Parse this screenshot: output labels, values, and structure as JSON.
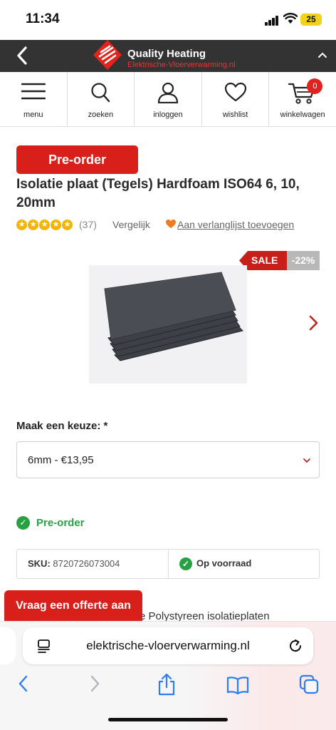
{
  "status_bar": {
    "time": "11:34",
    "battery": "25"
  },
  "header": {
    "brand_title": "Quality Heating",
    "brand_subtitle": "Elektrische-Vloerverwarming.nl"
  },
  "nav": {
    "items": [
      {
        "label": "menu",
        "icon": "hamburger-icon"
      },
      {
        "label": "zoeken",
        "icon": "search-icon"
      },
      {
        "label": "inloggen",
        "icon": "user-icon"
      },
      {
        "label": "wishlist",
        "icon": "heart-icon"
      },
      {
        "label": "winkelwagen",
        "icon": "cart-icon"
      }
    ],
    "cart_count": "0"
  },
  "product": {
    "badge": "Pre-order",
    "title": "Isolatie plaat (Tegels) Hardfoam ISO64 6, 10, 20mm",
    "rating_stars": 5,
    "review_count": "(37)",
    "compare_label": "Vergelijk",
    "wishlist_label": "Aan verlanglijst toevoegen",
    "sale_label": "SALE",
    "discount": "-22%",
    "choice_label": "Maak een keuze: *",
    "selected_option": "6mm - €13,95",
    "stock_status": "Pre-order",
    "sku_label": "SKU:",
    "sku_value": "8720726073004",
    "availability": "Op voorraad",
    "description_peek": "e Polystyreen isolatieplaten",
    "offer_button": "Vraag een offerte aan"
  },
  "browser": {
    "url": "elektrische-vloerverwarming.nl"
  },
  "colors": {
    "accent_red": "#d81f1a",
    "header_dark": "#333333",
    "success_green": "#27a243",
    "star_gold": "#f5b400"
  }
}
